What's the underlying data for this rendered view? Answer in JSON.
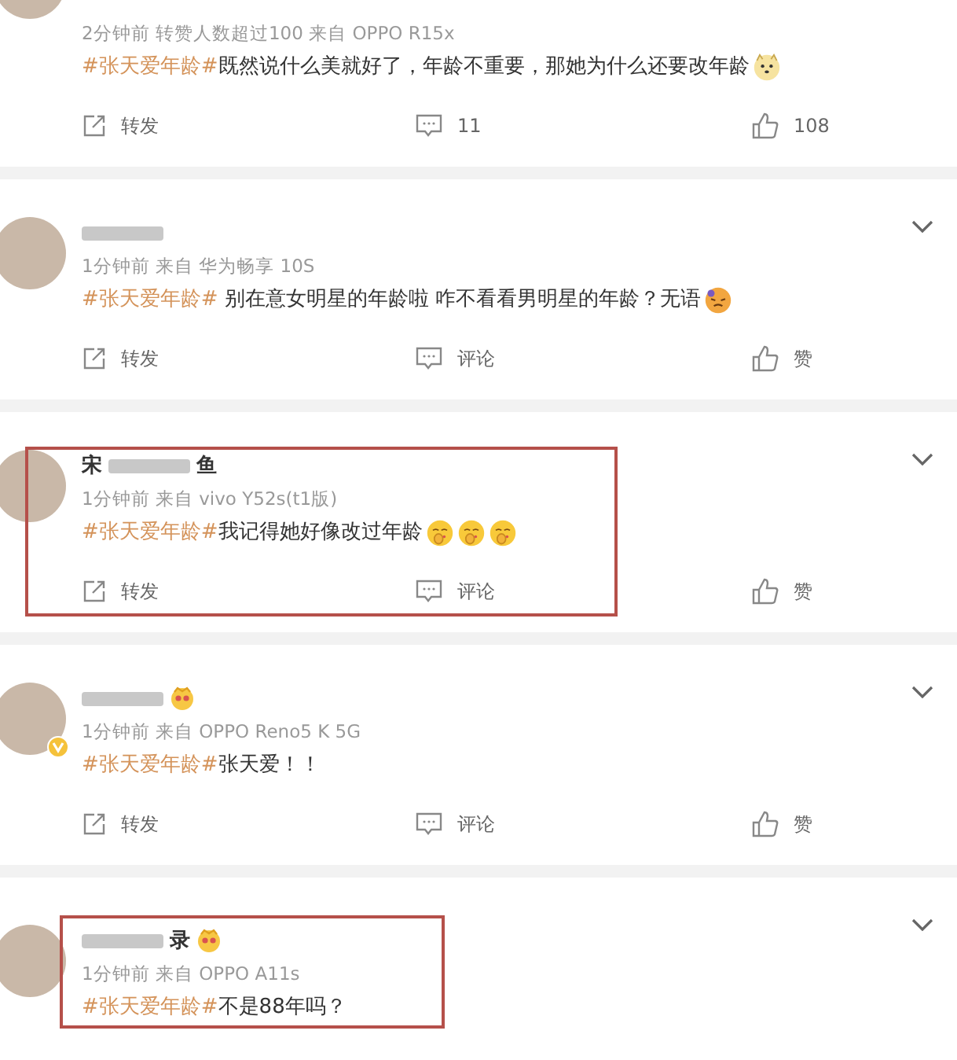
{
  "comments": [
    {
      "name_badge": false,
      "verified": false,
      "highlighted": false,
      "chevron": false,
      "meta": "2分钟前 转赞人数超过100 来自 OPPO R15x",
      "topic": "#张天爱年龄#",
      "text": "既然说什么美就好了，年龄不重要，那她为什么还要改年龄",
      "emojis": [
        {
          "kind": "dog"
        }
      ],
      "actions": [
        {
          "kind": "repost",
          "label": "转发"
        },
        {
          "kind": "comment",
          "label": "11"
        },
        {
          "kind": "like",
          "label": "108"
        }
      ]
    },
    {
      "name": [
        {
          "kind": "redacted"
        }
      ],
      "name_badge": false,
      "verified": false,
      "highlighted": false,
      "chevron": true,
      "meta": "1分钟前 来自 华为畅享 10S",
      "topic": "#张天爱年龄#",
      "text": " 别在意女明星的年龄啦 咋不看看男明星的年龄？无语",
      "emojis": [
        {
          "kind": "sad"
        }
      ],
      "actions": [
        {
          "kind": "repost",
          "label": "转发"
        },
        {
          "kind": "comment",
          "label": "评论"
        },
        {
          "kind": "like",
          "label": "赞"
        }
      ]
    },
    {
      "name": [
        {
          "kind": "text",
          "text": "宋"
        },
        {
          "kind": "redacted"
        },
        {
          "kind": "text",
          "text": "鱼"
        }
      ],
      "name_badge": false,
      "verified": false,
      "highlighted": true,
      "chevron": true,
      "meta": "1分钟前 来自 vivo Y52s(t1版)",
      "topic": "#张天爱年龄#",
      "text": "我记得她好像改过年龄",
      "emojis": [
        {
          "kind": "shush"
        },
        {
          "kind": "shush"
        },
        {
          "kind": "shush"
        }
      ],
      "actions": [
        {
          "kind": "repost",
          "label": "转发"
        },
        {
          "kind": "comment",
          "label": "评论"
        },
        {
          "kind": "like",
          "label": "赞"
        }
      ]
    },
    {
      "name": [
        {
          "kind": "redacted"
        }
      ],
      "name_badge": true,
      "verified": true,
      "highlighted": false,
      "chevron": true,
      "meta": "1分钟前 来自 OPPO Reno5 K 5G",
      "topic": "#张天爱年龄#",
      "text": "张天爱！！",
      "actions": [
        {
          "kind": "repost",
          "label": "转发"
        },
        {
          "kind": "comment",
          "label": "评论"
        },
        {
          "kind": "like",
          "label": "赞"
        }
      ]
    },
    {
      "name": [
        {
          "kind": "redacted"
        },
        {
          "kind": "text",
          "text": "录"
        }
      ],
      "name_badge": true,
      "verified": false,
      "highlighted": true,
      "chevron": true,
      "meta": "1分钟前 来自 OPPO A11s",
      "topic": "#张天爱年龄#",
      "text": "不是88年吗？"
    }
  ]
}
